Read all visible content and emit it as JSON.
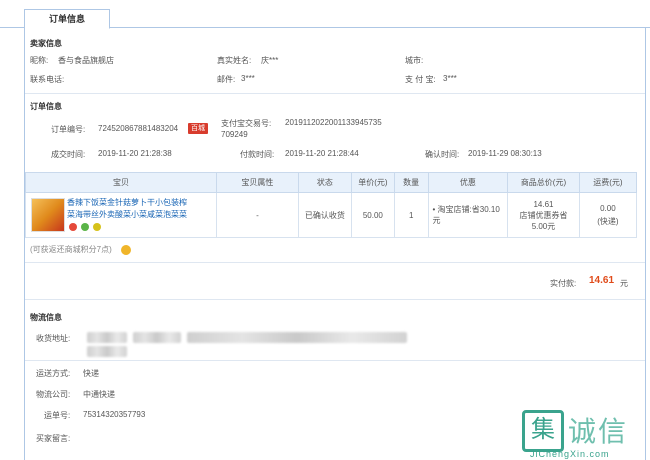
{
  "tab": {
    "label": "订单信息"
  },
  "seller": {
    "section_title": "卖家信息",
    "nick_label": "昵称:",
    "nick_value": "香与食品旗舰店",
    "realname_label": "真实姓名:",
    "realname_value": "庆***",
    "city_label": "城市:",
    "phone_label": "联系电话:",
    "email_label": "邮件:",
    "email_value": "3***",
    "alipay_label": "支 付 宝:",
    "alipay_value": "3***"
  },
  "order": {
    "section_title": "订单信息",
    "order_no_label": "订单编号:",
    "order_no_value": "724520867881483204",
    "order_no_badge": "百城",
    "alipay_trade_label": "支付宝交易号:",
    "alipay_trade_value_1": "2019112022001133945735",
    "alipay_trade_value_2": "709249",
    "created_label": "成交时间:",
    "created_value": "2019-11-20 21:28:38",
    "paid_label": "付款时间:",
    "paid_value": "2019-11-20 21:28:44",
    "confirmed_label": "确认时间:",
    "confirmed_value": "2019-11-29 08:30:13"
  },
  "goods": {
    "headers": [
      "宝贝",
      "宝贝属性",
      "状态",
      "单价(元)",
      "数量",
      "优惠",
      "商品总价(元)",
      "运费(元)"
    ],
    "item": {
      "title": "香辣下饭菜金针菇萝卜干小包装榨菜海带丝外卖酸菜小菜咸菜泡菜菜",
      "attr": "-",
      "status": "已确认收货",
      "price": "50.00",
      "qty": "1",
      "discount": "• 淘宝店铺:省30.10元",
      "total_1": "14.61",
      "total_2": "店铺优惠券省",
      "total_3": "5.00元",
      "shipping_1": "0.00",
      "shipping_2": "(快递)"
    },
    "note": "(可获返还商城积分7点)"
  },
  "payment": {
    "label": "实付款:",
    "amount": "14.61",
    "unit": "元"
  },
  "logistics": {
    "section_title": "物流信息",
    "address_label": "收货地址:",
    "method_label": "运送方式:",
    "method_value": "快递",
    "company_label": "物流公司:",
    "company_value": "中通快递",
    "tracking_label": "运单号:",
    "tracking_value": "75314320357793",
    "buyer_msg_label": "买家留言:"
  },
  "watermark": {
    "glyph": "集",
    "text": "诚信",
    "url": "JiChengXin.com"
  },
  "colors": {
    "accent": "#1a66b5",
    "price_red": "#e04b1a",
    "border": "#aec7e5",
    "header_bg": "#e8f1fb"
  }
}
